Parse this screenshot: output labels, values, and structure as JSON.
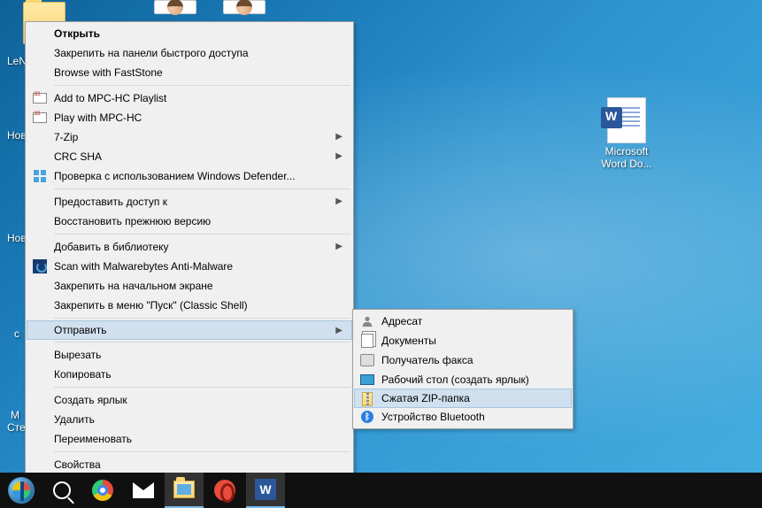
{
  "desktop": {
    "partial_labels": [
      "LeN",
      "Нов",
      "Нов",
      "c",
      "M",
      "Сте"
    ],
    "word_icon_label": "Microsoft Word Do..."
  },
  "context_menu": {
    "items": [
      {
        "label": "Открыть",
        "bold": true
      },
      {
        "label": "Закрепить на панели быстрого доступа"
      },
      {
        "label": "Browse with FastStone"
      },
      {
        "sep": true
      },
      {
        "label": "Add to MPC-HC Playlist",
        "icon": "mpc"
      },
      {
        "label": "Play with MPC-HC",
        "icon": "mpc"
      },
      {
        "label": "7-Zip",
        "submenu": true
      },
      {
        "label": "CRC SHA",
        "submenu": true
      },
      {
        "label": "Проверка с использованием Windows Defender...",
        "icon": "defender"
      },
      {
        "sep": true
      },
      {
        "label": "Предоставить доступ к",
        "submenu": true
      },
      {
        "label": "Восстановить прежнюю версию"
      },
      {
        "sep": true
      },
      {
        "label": "Добавить в библиотеку",
        "submenu": true
      },
      {
        "label": "Scan with Malwarebytes Anti-Malware",
        "icon": "mbam"
      },
      {
        "label": "Закрепить на начальном экране"
      },
      {
        "label": "Закрепить в меню \"Пуск\" (Classic Shell)"
      },
      {
        "sep": true
      },
      {
        "label": "Отправить",
        "submenu": true,
        "hovered": true
      },
      {
        "sep": true
      },
      {
        "label": "Вырезать"
      },
      {
        "label": "Копировать"
      },
      {
        "sep": true
      },
      {
        "label": "Создать ярлык"
      },
      {
        "label": "Удалить"
      },
      {
        "label": "Переименовать"
      },
      {
        "sep": true
      },
      {
        "label": "Свойства"
      }
    ]
  },
  "submenu": {
    "items": [
      {
        "label": "Адресат",
        "icon": "person"
      },
      {
        "label": "Документы",
        "icon": "docs"
      },
      {
        "label": "Получатель факса",
        "icon": "fax"
      },
      {
        "label": "Рабочий стол (создать ярлык)",
        "icon": "desk"
      },
      {
        "label": "Сжатая ZIP-папка",
        "icon": "zip",
        "hovered": true
      },
      {
        "label": "Устройство Bluetooth",
        "icon": "bt"
      }
    ]
  },
  "taskbar": {
    "buttons": [
      "start",
      "search",
      "chrome",
      "mail",
      "explorer",
      "opera",
      "word"
    ]
  }
}
